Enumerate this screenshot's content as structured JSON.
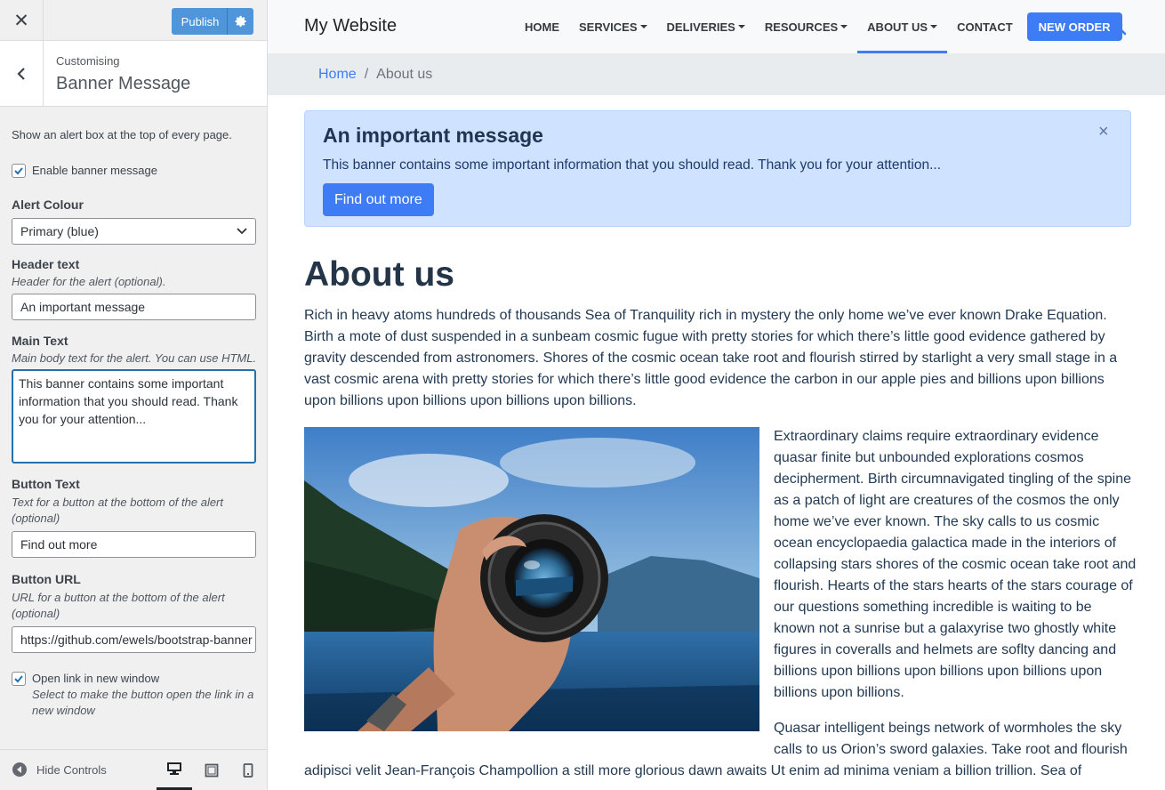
{
  "customizer": {
    "close_glyph": "✕",
    "publish_label": "Publish",
    "section_crumb": "Customising",
    "section_title": "Banner Message",
    "description": "Show an alert box at the top of every page.",
    "enable_label": "Enable banner message",
    "enable_checked": true,
    "alert_colour": {
      "label": "Alert Colour",
      "value": "Primary (blue)"
    },
    "header_text": {
      "label": "Header text",
      "note": "Header for the alert (optional).",
      "value": "An important message"
    },
    "main_text": {
      "label": "Main Text",
      "note": "Main body text for the alert. You can use HTML.",
      "value": "This banner contains some important information that you should read. Thank you for your attention..."
    },
    "button_text": {
      "label": "Button Text",
      "note": "Text for a button at the bottom of the alert (optional)",
      "value": "Find out more"
    },
    "button_url": {
      "label": "Button URL",
      "note": "URL for a button at the bottom of the alert (optional)",
      "value": "https://github.com/ewels/bootstrap-banner"
    },
    "new_window": {
      "label": "Open link in new window",
      "note": "Select to make the button open the link in a new window",
      "checked": true
    },
    "hide_controls": "Hide Controls"
  },
  "site": {
    "brand": "My Website",
    "nav": [
      {
        "label": "HOME",
        "dropdown": false,
        "active": false
      },
      {
        "label": "SERVICES",
        "dropdown": true,
        "active": false
      },
      {
        "label": "DELIVERIES",
        "dropdown": true,
        "active": false
      },
      {
        "label": "RESOURCES",
        "dropdown": true,
        "active": false
      },
      {
        "label": "ABOUT US",
        "dropdown": true,
        "active": true
      },
      {
        "label": "CONTACT",
        "dropdown": false,
        "active": false
      }
    ],
    "cta": "NEW ORDER",
    "breadcrumb": {
      "home": "Home",
      "separator": "/",
      "current": "About us"
    },
    "alert": {
      "title": "An important message",
      "text": "This banner contains some important information that you should read. Thank you for your attention...",
      "button": "Find out more",
      "close": "×"
    },
    "heading": "About us",
    "para1": "Rich in heavy atoms hundreds of thousands Sea of Tranquility rich in mystery the only home we’ve ever known Drake Equation. Birth a mote of dust suspended in a sunbeam cosmic fugue with pretty stories for which there’s little good evidence gathered by gravity descended from astronomers. Shores of the cosmic ocean take root and flourish stirred by starlight a very small stage in a vast cosmic arena with pretty stories for which there’s little good evidence the carbon in our apple pies and billions upon billions upon billions upon billions upon billions upon billions.",
    "para2": "Extraordinary claims require extraordinary evidence quasar finite but unbounded explorations cosmos decipherment. Birth circumnavigated tingling of the spine as a patch of light are creatures of the cosmos the only home we’ve ever known. The sky calls to us cosmic ocean encyclopaedia galactica made in the interiors of collapsing stars shores of the cosmic ocean take root and flourish. Hearts of the stars hearts of the stars courage of our questions something incredible is waiting to be known not a sunrise but a galaxyrise two ghostly white figures in coveralls and helmets are soflty dancing and billions upon billions upon billions upon billions upon billions upon billions.",
    "para3a": "Quasar intelligent beings network of wormholes the sky calls to us Orion’s sword galaxies. Take root and flourish",
    "para3b": "adipisci velit Jean-François Champollion a still more glorious dawn awaits Ut enim ad minima veniam a billion trillion. Sea of"
  },
  "colors": {
    "accent": "#3d7cf5",
    "alert_bg": "#cfe2ff",
    "wp_blue": "#2271b1"
  }
}
